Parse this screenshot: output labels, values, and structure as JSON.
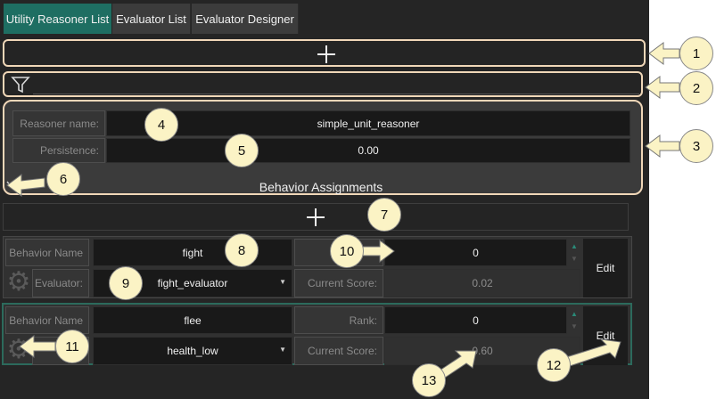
{
  "tabs": [
    {
      "label": "Utility Reasoner List"
    },
    {
      "label": "Evaluator List"
    },
    {
      "label": "Evaluator Designer"
    }
  ],
  "reasoner": {
    "name_label": "Reasoner name:",
    "name_value": "simple_unit_reasoner",
    "persistence_label": "Persistence:",
    "persistence_value": "0.00",
    "section_title": "Behavior Assignments"
  },
  "behaviors": [
    {
      "name_label": "Behavior Name",
      "name": "fight",
      "rank_label": "",
      "rank": "0",
      "evaluator_label": "Evaluator:",
      "evaluator": "fight_evaluator",
      "score_label": "Current Score:",
      "score": "0.02",
      "edit_label": "Edit"
    },
    {
      "name_label": "Behavior Name",
      "name": "flee",
      "rank_label": "Rank:",
      "rank": "0",
      "evaluator_label": "",
      "evaluator": "health_low",
      "score_label": "Current Score:",
      "score": "0.60",
      "edit_label": "Edit"
    }
  ],
  "callouts": [
    "1",
    "2",
    "3",
    "4",
    "5",
    "6",
    "7",
    "8",
    "9",
    "10",
    "11",
    "12",
    "13"
  ],
  "icons": {
    "add": "plus-icon",
    "filter": "funnel-icon",
    "collapse": "chevron-down-icon",
    "gear": "gear-icon",
    "spinner": "spinner-arrows-icon",
    "dropdown": "dropdown-caret-icon"
  },
  "colors": {
    "active_tab": "#1e6e62",
    "highlight_border": "#f0d7b8",
    "selected_card_border": "#2c6a5c",
    "callout_fill": "#fbf3c5"
  }
}
